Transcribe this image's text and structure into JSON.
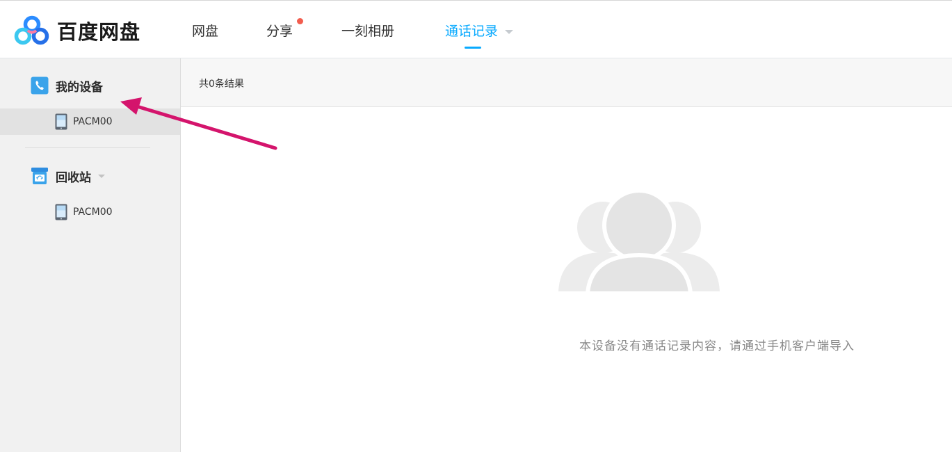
{
  "header": {
    "logo_text": "百度网盘",
    "tabs": [
      {
        "label": "网盘"
      },
      {
        "label": "分享",
        "has_notification": true
      },
      {
        "label": "一刻相册"
      },
      {
        "label": "通话记录",
        "active": true,
        "has_dropdown": true
      }
    ]
  },
  "sidebar": {
    "my_devices": {
      "label": "我的设备",
      "devices": [
        {
          "name": "PACM00",
          "selected": true
        }
      ]
    },
    "recycle_bin": {
      "label": "回收站",
      "has_dropdown": true,
      "devices": [
        {
          "name": "PACM00"
        }
      ]
    }
  },
  "main": {
    "result_count": "共0条结果",
    "empty_message": "本设备没有通话记录内容，请通过手机客户端导入"
  },
  "colors": {
    "accent": "#09aaff",
    "notification_dot": "#f25d4e",
    "annotation_arrow": "#d4146c",
    "illustration": "#e6e6e6"
  },
  "icons": {
    "logo": "baidu-netdisk-cloud-logo",
    "my_devices": "phone-icon",
    "recycle_bin": "recycle-bin-icon",
    "device": "mobile-device-icon",
    "empty_state": "contacts-people-icon"
  }
}
